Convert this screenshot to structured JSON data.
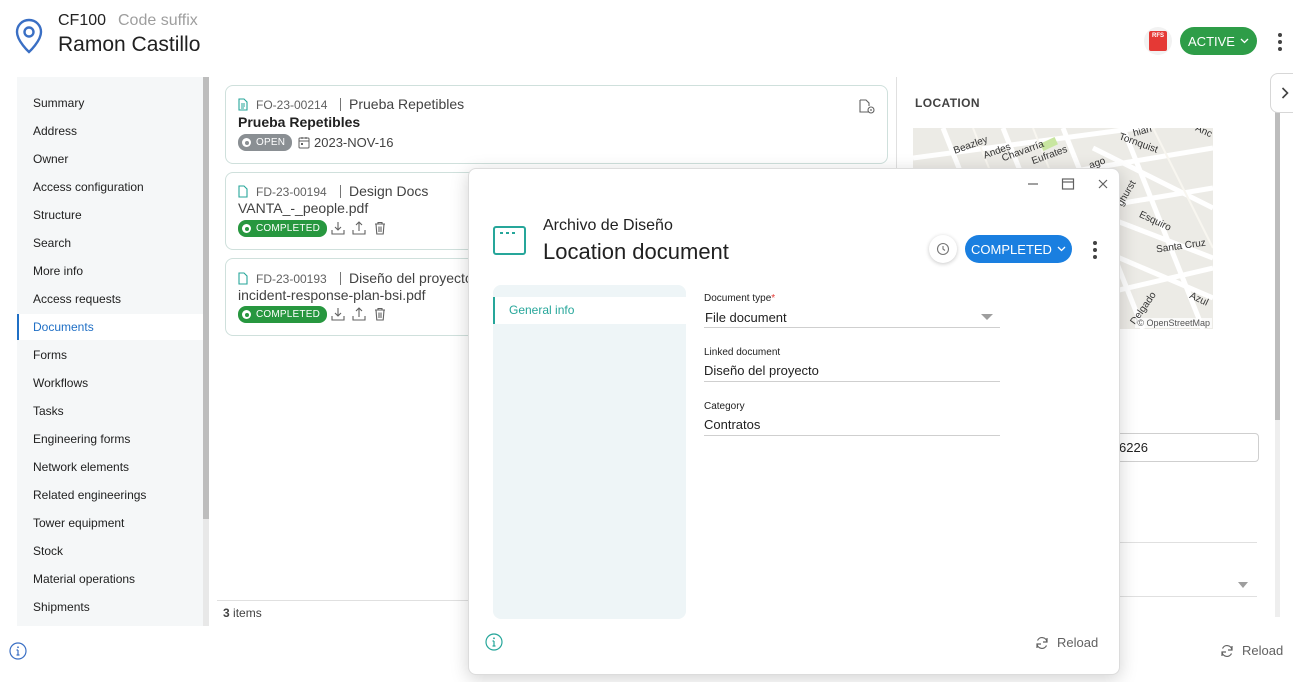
{
  "header": {
    "code": "CF100",
    "code_suffix": "Code suffix",
    "name": "Ramon Castillo",
    "brand_logo_text": "RFS",
    "status": "ACTIVE"
  },
  "sidebar": {
    "items": [
      {
        "label": "Summary"
      },
      {
        "label": "Address"
      },
      {
        "label": "Owner"
      },
      {
        "label": "Access configuration"
      },
      {
        "label": "Structure"
      },
      {
        "label": "Search"
      },
      {
        "label": "More info"
      },
      {
        "label": "Access requests"
      },
      {
        "label": "Documents",
        "active": true
      },
      {
        "label": "Forms"
      },
      {
        "label": "Workflows"
      },
      {
        "label": "Tasks"
      },
      {
        "label": "Engineering forms"
      },
      {
        "label": "Network elements"
      },
      {
        "label": "Related engineerings"
      },
      {
        "label": "Tower equipment"
      },
      {
        "label": "Stock"
      },
      {
        "label": "Material operations"
      },
      {
        "label": "Shipments"
      }
    ]
  },
  "documents": [
    {
      "id": "FO-23-00214",
      "title": "Prueba Repetibles",
      "subtitle": "Prueba Repetibles",
      "status": "OPEN",
      "date": "2023-NOV-16"
    },
    {
      "id": "FD-23-00194",
      "title": "Design Docs",
      "subtitle": "VANTA_-_people.pdf",
      "status": "COMPLETED"
    },
    {
      "id": "FD-23-00193",
      "title": "Diseño del proyecto",
      "subtitle": "incident-response-plan-bsi.pdf",
      "status": "COMPLETED"
    }
  ],
  "list_footer": {
    "count": "3",
    "label": "items"
  },
  "right_panel": {
    "location_label": "LOCATION",
    "map_credit": "© OpenStreetMap",
    "streets": [
      "Beazley",
      "Andes",
      "Chavarría",
      "Eufrates",
      "Tornquist",
      "Esquiro",
      "Santa Cruz",
      "Azul",
      "Delgado",
      "hiari",
      "ghurst",
      "ago",
      "Anc"
    ],
    "field_value": "6226",
    "reload_label": "Reload"
  },
  "modal": {
    "subtitle": "Archivo de Diseño",
    "title": "Location document",
    "status": "COMPLETED",
    "tab": "General info",
    "fields": [
      {
        "label": "Document type",
        "required": "*",
        "value": "File document"
      },
      {
        "label": "Linked document",
        "value": "Diseño del proyecto"
      },
      {
        "label": "Category",
        "value": "Contratos"
      }
    ],
    "reload_label": "Reload"
  },
  "colors": {
    "accent_teal": "#26a69a",
    "active_green": "#2e9d48",
    "completed_green": "#27973f",
    "completed_blue": "#1a7fe0",
    "open_grey": "#8a8f93",
    "nav_active": "#1f6fc5"
  }
}
